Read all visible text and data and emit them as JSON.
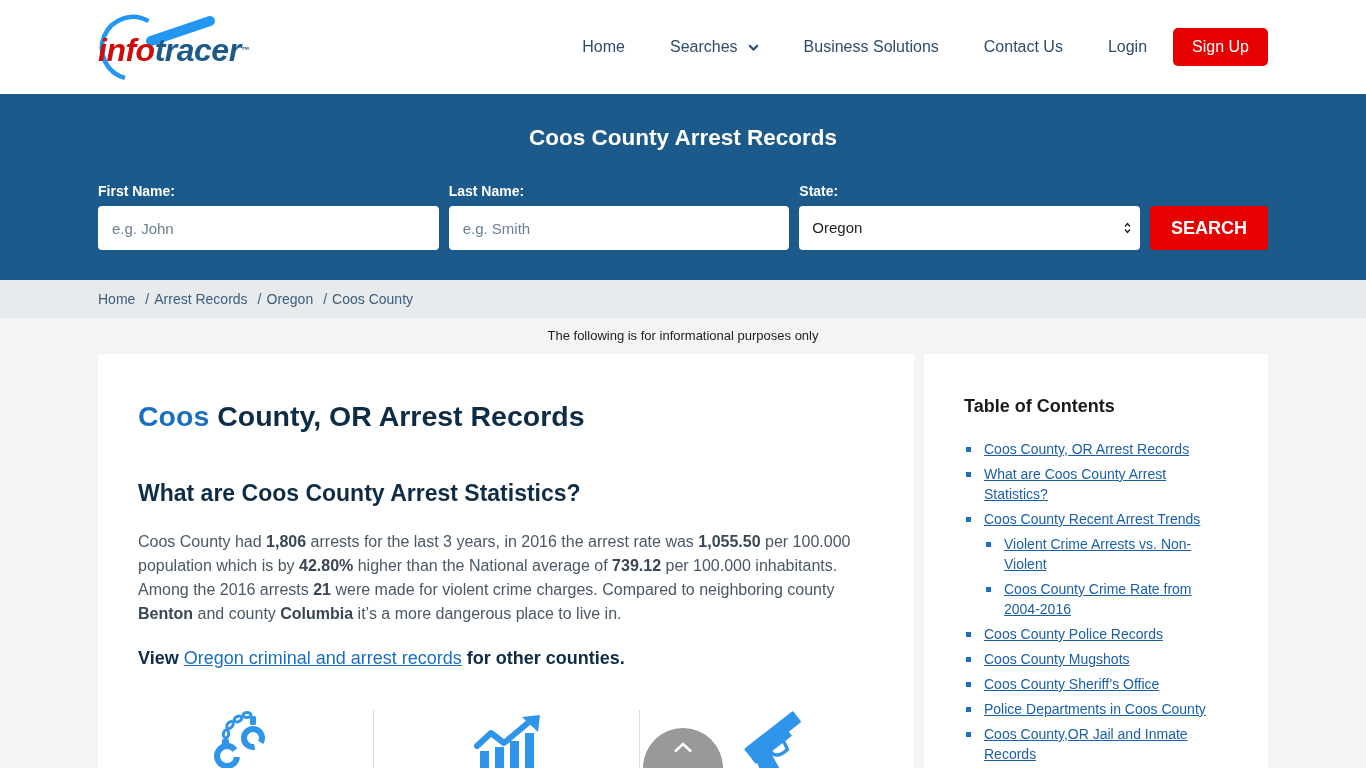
{
  "header": {
    "logo": {
      "first": "info",
      "second": "tracer",
      "mark": "™"
    },
    "nav": [
      {
        "label": "Home",
        "kind": "link"
      },
      {
        "label": "Searches",
        "kind": "dropdown"
      },
      {
        "label": "Business Solutions",
        "kind": "link"
      },
      {
        "label": "Contact Us",
        "kind": "link"
      },
      {
        "label": "Login",
        "kind": "link"
      }
    ],
    "signup_button": "Sign Up"
  },
  "search": {
    "title": "Coos County Arrest Records",
    "fields": [
      {
        "kind": "text",
        "label": "First Name:",
        "placeholder": "e.g. John"
      },
      {
        "kind": "text",
        "label": "Last Name:",
        "placeholder": "e.g. Smith"
      },
      {
        "kind": "select",
        "label": "State:",
        "value": "Oregon"
      }
    ],
    "button": "SEARCH"
  },
  "breadcrumb": {
    "separator": "/",
    "items": [
      "Home",
      "Arrest Records",
      "Oregon",
      "Coos County"
    ]
  },
  "notice": "The following is for informational purposes only",
  "article": {
    "title": {
      "highlight": "Coos",
      "rest": "County, OR Arrest Records"
    },
    "heading": "What are Coos County Arrest Statistics?",
    "paragraph": "Coos County had **1,806** arrests for the last 3 years, in 2016 the arrest rate was **1,055.50** per 100.000 population which is by **42.80%** higher than the National average of **739.12** per 100.000 inhabitants. Among the 2016 arrests **21** were made for violent crime charges. Compared to neighboring county **Benton** and county **Columbia** it’s a more dangerous place to live in.",
    "view_line": {
      "before": "View",
      "link": "Oregon criminal and arrest records",
      "after": "for other counties."
    }
  },
  "toc": {
    "title": "Table of Contents",
    "items": [
      {
        "label": "Coos County, OR Arrest Records"
      },
      {
        "label": "What are Coos County Arrest Statistics?"
      },
      {
        "label": "Coos County Recent Arrest Trends",
        "children": [
          {
            "label": "Violent Crime Arrests vs. Non-Violent"
          },
          {
            "label": "Coos County Crime Rate from 2004-2016"
          }
        ]
      },
      {
        "label": "Coos County Police Records"
      },
      {
        "label": "Coos County Mugshots"
      },
      {
        "label": "Coos County Sheriff’s Office"
      },
      {
        "label": "Police Departments in Coos County"
      },
      {
        "label": "Coos County,OR Jail and Inmate Records"
      }
    ]
  }
}
